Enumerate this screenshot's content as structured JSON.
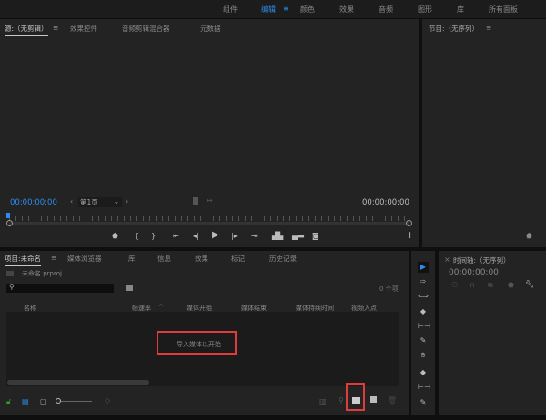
{
  "workspaces": [
    "组件",
    "编辑",
    "颜色",
    "效果",
    "音频",
    "图形",
    "库",
    "所有面板"
  ],
  "active_workspace": "编辑",
  "source_panel": {
    "tabs": [
      "源:（无剪辑）",
      "效果控件",
      "音频剪辑混合器",
      "元数据"
    ],
    "timecode_left": "00;00;00;00",
    "timecode_right": "00;00;00;00",
    "page_select": "第1页"
  },
  "program_panel": {
    "title": "节目:（无序列）"
  },
  "project_panel": {
    "tabs": [
      "项目:未命名",
      "媒体浏览器",
      "库",
      "信息",
      "效果",
      "标记",
      "历史记录"
    ],
    "project_file": "未命名.prproj",
    "search_placeholder": "",
    "item_count": "0 个项",
    "columns": [
      "名称",
      "帧速率",
      "媒体开始",
      "媒体结束",
      "媒体持续时间",
      "视频入点"
    ],
    "empty_message": "导入媒体以开始"
  },
  "timeline_panel": {
    "title": "时间轴:（无序列）",
    "timecode": "00;00;00;00"
  },
  "colors": {
    "accent": "#2d8ceb",
    "highlight": "#e03c3c",
    "bg": "#232323"
  }
}
